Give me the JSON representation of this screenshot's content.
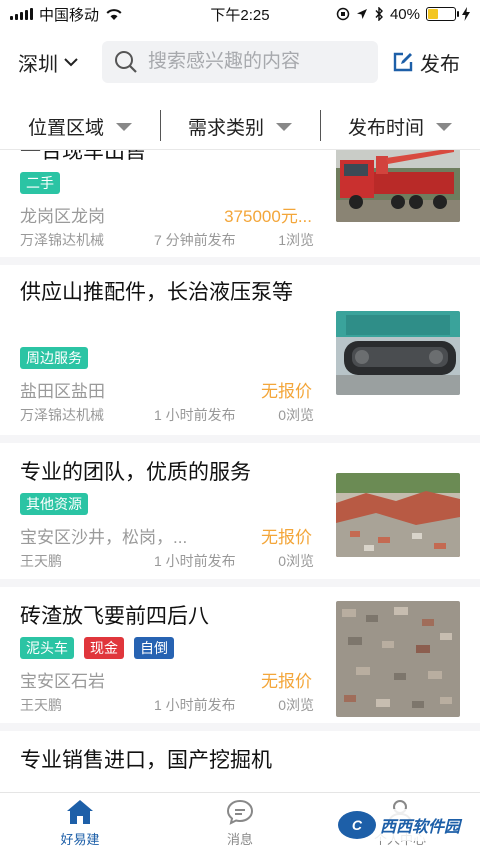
{
  "status_bar": {
    "carrier": "中国移动",
    "time": "下午2:25",
    "battery": "40%",
    "battery_level": 0.4
  },
  "header": {
    "city": "深圳",
    "search_placeholder": "搜索感兴趣的内容",
    "publish_label": "发布"
  },
  "filters": [
    "位置区域",
    "需求类别",
    "发布时间"
  ],
  "listings": [
    {
      "title": "一台现车出售",
      "tags": [
        {
          "label": "二手",
          "color": "#2bc4a4"
        }
      ],
      "location": "龙岗区龙岗",
      "price": "375000元...",
      "publisher": "万泽锦达机械",
      "time": "7 分钟前发布",
      "views": "1浏览",
      "thumb": "red-truck-crane"
    },
    {
      "title": "供应山推配件，长治液压泵等",
      "tags": [
        {
          "label": "周边服务",
          "color": "#2bc4a4"
        }
      ],
      "location": "盐田区盐田",
      "price": "无报价",
      "publisher": "万泽锦达机械",
      "time": "1 小时前发布",
      "views": "0浏览",
      "thumb": "excavator-track"
    },
    {
      "title": "专业的团队，优质的服务",
      "tags": [
        {
          "label": "其他资源",
          "color": "#2bc4a4"
        }
      ],
      "location": "宝安区沙井，松岗，...",
      "price": "无报价",
      "publisher": "王天鹏",
      "time": "1 小时前发布",
      "views": "0浏览",
      "thumb": "brick-debris"
    },
    {
      "title": "砖渣放飞要前四后八",
      "tags": [
        {
          "label": "泥头车",
          "color": "#2bc4a4"
        },
        {
          "label": "现金",
          "color": "#e0363c"
        },
        {
          "label": "自倒",
          "color": "#2763b2"
        }
      ],
      "location": "宝安区石岩",
      "price": "无报价",
      "publisher": "王天鹏",
      "time": "1 小时前发布",
      "views": "0浏览",
      "thumb": "brick-rubble"
    },
    {
      "title": "专业销售进口，国产挖掘机"
    }
  ],
  "tabbar": {
    "tabs": [
      {
        "label": "好易建",
        "icon": "home-icon",
        "active": true
      },
      {
        "label": "消息",
        "icon": "message-icon",
        "active": false
      },
      {
        "label": "个人中心",
        "icon": "user-icon",
        "active": false
      }
    ],
    "accent": "#1d5fa8"
  },
  "watermark": {
    "logo": "C",
    "brand": "西西软件园",
    "domain": "CR173.COM"
  }
}
